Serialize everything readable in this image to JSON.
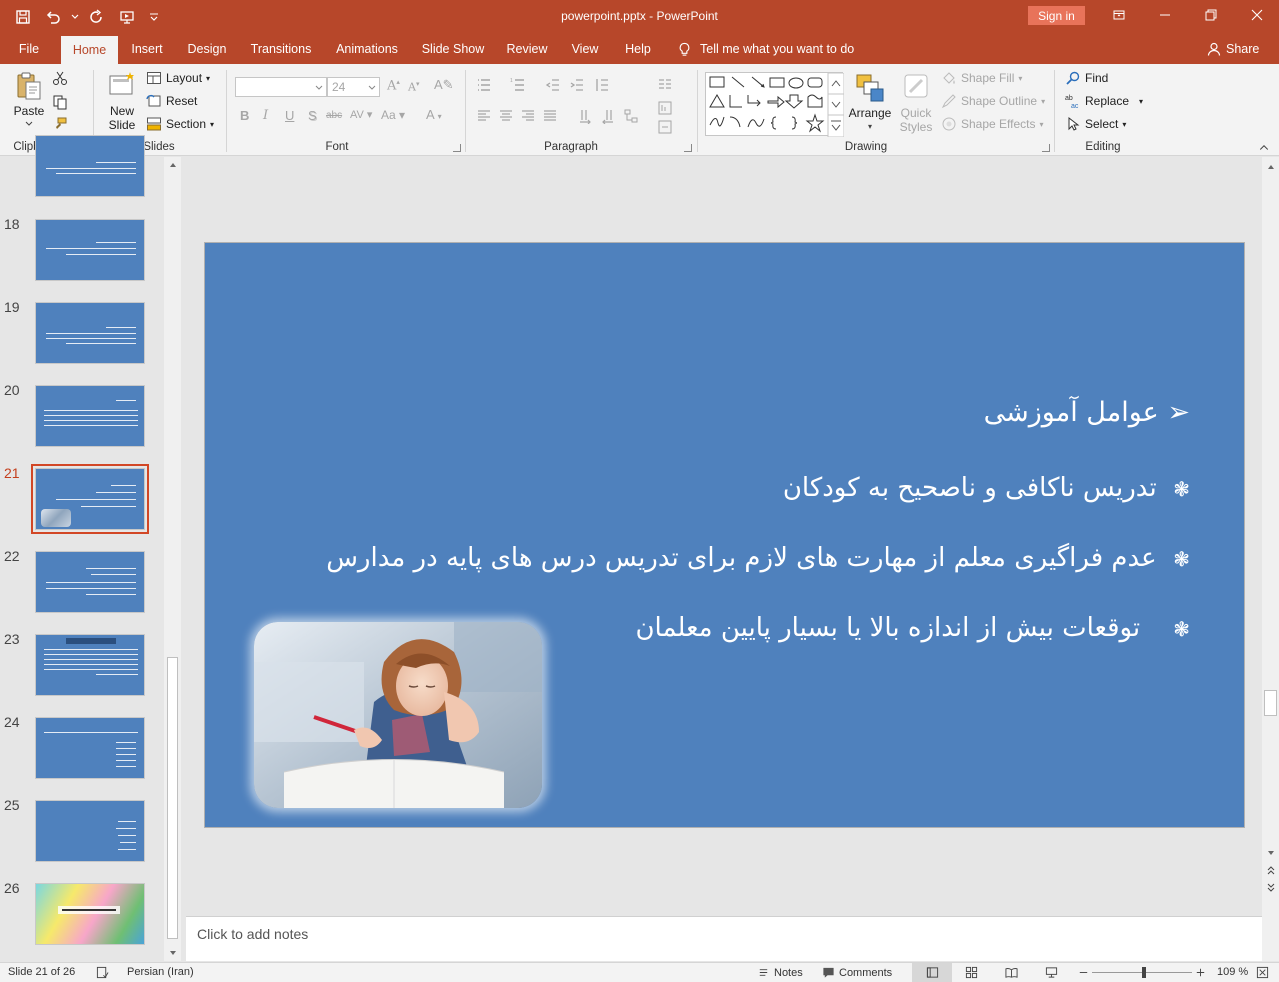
{
  "window": {
    "title": "powerpoint.pptx  -  PowerPoint",
    "sign_in": "Sign in"
  },
  "tabs": [
    {
      "label": "File"
    },
    {
      "label": "Home",
      "active": true
    },
    {
      "label": "Insert"
    },
    {
      "label": "Design"
    },
    {
      "label": "Transitions"
    },
    {
      "label": "Animations"
    },
    {
      "label": "Slide Show"
    },
    {
      "label": "Review"
    },
    {
      "label": "View"
    },
    {
      "label": "Help"
    }
  ],
  "tell_me": "Tell me what you want to do",
  "share": "Share",
  "ribbon": {
    "clipboard": {
      "label": "Clipboard",
      "paste": "Paste"
    },
    "slides": {
      "label": "Slides",
      "new_slide_1": "New",
      "new_slide_2": "Slide",
      "layout": "Layout",
      "reset": "Reset",
      "section": "Section"
    },
    "font": {
      "label": "Font",
      "size_value": "24"
    },
    "paragraph": {
      "label": "Paragraph"
    },
    "drawing": {
      "label": "Drawing",
      "arrange": "Arrange",
      "quick_styles_1": "Quick",
      "quick_styles_2": "Styles",
      "shape_fill": "Shape Fill",
      "shape_outline": "Shape Outline",
      "shape_effects": "Shape Effects"
    },
    "editing": {
      "label": "Editing",
      "find": "Find",
      "replace": "Replace",
      "select": "Select"
    }
  },
  "thumbnails": [
    {
      "num": "18"
    },
    {
      "num": "19"
    },
    {
      "num": "20"
    },
    {
      "num": "21",
      "selected": true
    },
    {
      "num": "22"
    },
    {
      "num": "23"
    },
    {
      "num": "24"
    },
    {
      "num": "25"
    },
    {
      "num": "26"
    }
  ],
  "slide": {
    "heading": "عوامل آموزشی",
    "heading_bullet": "➢",
    "bullet_symbol": "❃",
    "bullets": [
      "تدریس ناکافی و ناصحیح به کودکان",
      "عدم فراگیری معلم از مهارت های لازم برای تدریس درس های پایه در مدارس",
      "توقعات بیش از اندازه بالا یا بسیار پایین معلمان"
    ]
  },
  "notes_placeholder": "Click to add notes",
  "status": {
    "slide_info": "Slide 21 of 26",
    "language": "Persian (Iran)",
    "notes": "Notes",
    "comments": "Comments",
    "zoom": "109 %",
    "zoom_percent": 109
  },
  "colors": {
    "accent": "#b7472a",
    "slide_bg": "#4f81bd",
    "selection": "#d24726"
  }
}
